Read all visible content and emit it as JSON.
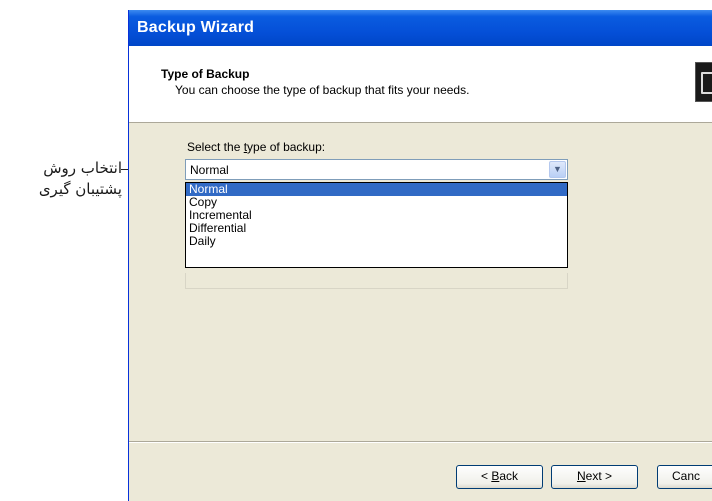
{
  "annotation": {
    "line1": "انتخاب روش",
    "line2": "پشتیبان گیری"
  },
  "window": {
    "title": "Backup Wizard"
  },
  "header": {
    "title": "Type of Backup",
    "description": "You can choose the type of backup that fits your needs."
  },
  "backup_type": {
    "label_pre": "Select the ",
    "label_access": "t",
    "label_post": "ype of backup:",
    "selected": "Normal",
    "options": [
      "Normal",
      "Copy",
      "Incremental",
      "Differential",
      "Daily"
    ]
  },
  "buttons": {
    "back_pre": "< ",
    "back_access": "B",
    "back_post": "ack",
    "next_access": "N",
    "next_post": "ext >",
    "cancel": "Canc"
  },
  "icons": {
    "dropdown_arrow": "chevron-down-icon",
    "wizard_header_icon": "backup-icon"
  }
}
